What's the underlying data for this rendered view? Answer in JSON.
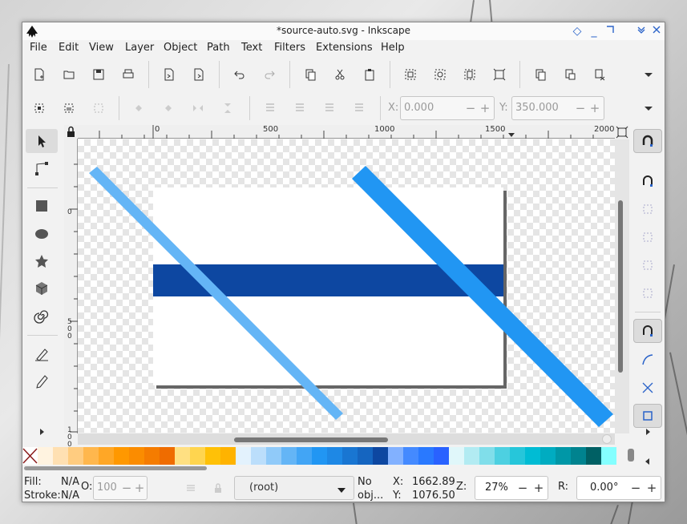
{
  "window": {
    "title": "*source-auto.svg - Inkscape"
  },
  "window_controls": [
    "diamond-icon",
    "minimize-icon",
    "maximize-icon",
    "shade-icon",
    "close-icon"
  ],
  "menu": [
    "File",
    "Edit",
    "View",
    "Layer",
    "Object",
    "Path",
    "Text",
    "Filters",
    "Extensions",
    "Help"
  ],
  "toolbar": {
    "icons": [
      "new-document-icon",
      "open-icon",
      "save-icon",
      "print-icon",
      "import-icon",
      "export-icon",
      "undo-icon",
      "redo-icon",
      "copy-icon",
      "cut-icon",
      "paste-icon",
      "zoom-selection-icon",
      "zoom-drawing-icon",
      "zoom-page-icon",
      "zoom-page-width-icon",
      "duplicate-icon",
      "clone-icon",
      "unlink-clone-icon",
      "overflow-icon"
    ]
  },
  "select_toolbar": {
    "x_label": "X:",
    "x_value": "0.000",
    "y_label": "Y:",
    "y_value": "350.000"
  },
  "ruler": {
    "h_ticks": [
      "0",
      "500",
      "1000",
      "1500",
      "2000"
    ],
    "v_ticks": [
      "0",
      "500",
      "1000"
    ]
  },
  "tools": [
    "select-tool-icon",
    "node-tool-icon",
    "rectangle-tool-icon",
    "ellipse-tool-icon",
    "star-tool-icon",
    "3d-box-tool-icon",
    "spiral-tool-icon",
    "pen-tool-icon",
    "pencil-tool-icon",
    "expand-icon"
  ],
  "snap_controls": [
    "snap-toggle-icon",
    "snap-bbox-icon",
    "snap-bbox-edge-icon",
    "snap-bbox-corner-icon",
    "snap-bbox-midpoint-icon",
    "snap-bbox-center-icon",
    "snap-nodes-icon",
    "snap-path-icon",
    "snap-intersection-icon",
    "snap-page-icon",
    "expand-icon"
  ],
  "drawing": {
    "colors": {
      "band": "#0d47a1",
      "stripe_light": "#64b5f6",
      "stripe_dark": "#2196f3",
      "page": "#ffffff"
    }
  },
  "palette": [
    "#fff3e0",
    "#ffe0b2",
    "#ffcc80",
    "#ffb74d",
    "#ffa726",
    "#ff9800",
    "#fb8c00",
    "#f57c00",
    "#ef6c00",
    "#ffe082",
    "#ffd54f",
    "#ffc107",
    "#ffb300",
    "#e3f2fd",
    "#bbdefb",
    "#90caf9",
    "#64b5f6",
    "#42a5f5",
    "#2196f3",
    "#1e88e5",
    "#1976d2",
    "#1565c0",
    "#0d47a1",
    "#82b1ff",
    "#448aff",
    "#2979ff",
    "#2962ff",
    "#e0f7fa",
    "#b2ebf2",
    "#80deea",
    "#4dd0e1",
    "#26c6da",
    "#00bcd4",
    "#00acc1",
    "#0097a7",
    "#00838f",
    "#006064",
    "#84ffff"
  ],
  "status": {
    "fill_label": "Fill:",
    "fill_value": "N/A",
    "stroke_label": "Stroke:",
    "stroke_value": "N/A",
    "opacity_label": "O:",
    "opacity_value": "100",
    "layer": "(root)",
    "no_objects": "No",
    "no_objects2": "obj...",
    "x_label": "X:",
    "x_value": "1662.89",
    "y_label": "Y:",
    "y_value": "1076.50",
    "zoom_label": "Z:",
    "zoom_value": "27%",
    "rotate_label": "R:",
    "rotate_value": "0.00°"
  }
}
